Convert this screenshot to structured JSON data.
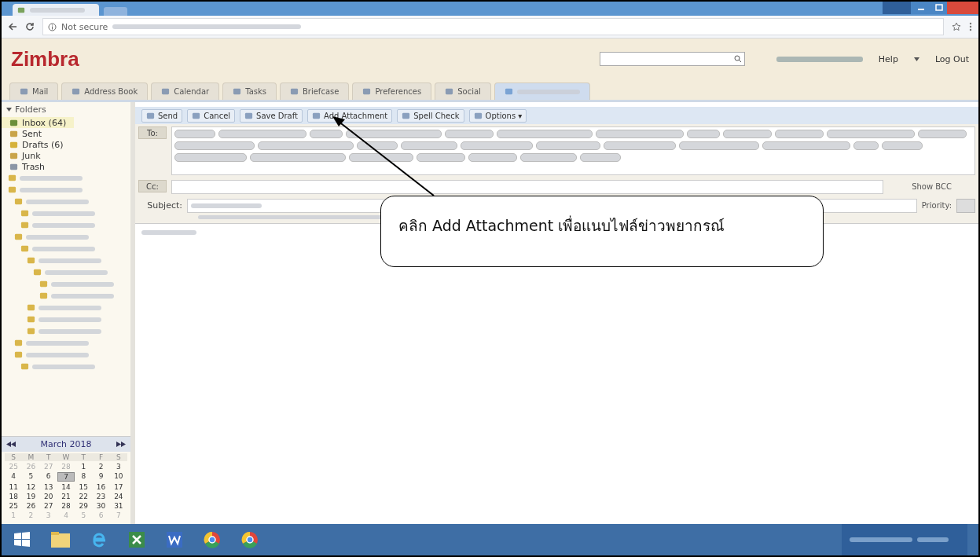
{
  "browser": {
    "security": "Not secure"
  },
  "header": {
    "logo": "Zimbra",
    "help": "Help",
    "logout": "Log Out"
  },
  "app_tabs": [
    {
      "label": "Mail",
      "selected": false
    },
    {
      "label": "Address Book",
      "selected": false
    },
    {
      "label": "Calendar",
      "selected": false
    },
    {
      "label": "Tasks",
      "selected": false
    },
    {
      "label": "Briefcase",
      "selected": false
    },
    {
      "label": "Preferences",
      "selected": false
    },
    {
      "label": "Social",
      "selected": false
    },
    {
      "selected": true
    }
  ],
  "sidebar": {
    "title": "Folders",
    "items": [
      {
        "label": "Inbox (64)",
        "selected": true
      },
      {
        "label": "Sent",
        "selected": false
      },
      {
        "label": "Drafts (6)",
        "selected": false
      },
      {
        "label": "Junk",
        "selected": false
      },
      {
        "label": "Trash",
        "selected": false
      }
    ]
  },
  "calendar": {
    "month": "March 2018",
    "weekdays": [
      "S",
      "M",
      "T",
      "W",
      "T",
      "F",
      "S"
    ],
    "weeks": [
      [
        {
          "d": "25",
          "other": true
        },
        {
          "d": "26",
          "other": true
        },
        {
          "d": "27",
          "other": true
        },
        {
          "d": "28",
          "other": true
        },
        {
          "d": "1"
        },
        {
          "d": "2"
        },
        {
          "d": "3"
        }
      ],
      [
        {
          "d": "4"
        },
        {
          "d": "5"
        },
        {
          "d": "6"
        },
        {
          "d": "7",
          "today": true
        },
        {
          "d": "8"
        },
        {
          "d": "9"
        },
        {
          "d": "10"
        }
      ],
      [
        {
          "d": "11"
        },
        {
          "d": "12"
        },
        {
          "d": "13"
        },
        {
          "d": "14"
        },
        {
          "d": "15"
        },
        {
          "d": "16"
        },
        {
          "d": "17"
        }
      ],
      [
        {
          "d": "18"
        },
        {
          "d": "19"
        },
        {
          "d": "20"
        },
        {
          "d": "21"
        },
        {
          "d": "22"
        },
        {
          "d": "23"
        },
        {
          "d": "24"
        }
      ],
      [
        {
          "d": "25"
        },
        {
          "d": "26"
        },
        {
          "d": "27"
        },
        {
          "d": "28"
        },
        {
          "d": "29"
        },
        {
          "d": "30"
        },
        {
          "d": "31"
        }
      ],
      [
        {
          "d": "1",
          "other": true
        },
        {
          "d": "2",
          "other": true
        },
        {
          "d": "3",
          "other": true
        },
        {
          "d": "4",
          "other": true
        },
        {
          "d": "5",
          "other": true
        },
        {
          "d": "6",
          "other": true
        },
        {
          "d": "7",
          "other": true
        }
      ]
    ]
  },
  "toolbar": [
    {
      "label": "Send"
    },
    {
      "label": "Cancel"
    },
    {
      "label": "Save Draft"
    },
    {
      "label": "Add Attachment"
    },
    {
      "label": "Spell Check"
    },
    {
      "label": "Options ▾"
    }
  ],
  "compose": {
    "to_label": "To:",
    "cc_label": "Cc:",
    "subject_label": "Subject:",
    "show_bcc": "Show BCC",
    "priority": "Priority:"
  },
  "callout": {
    "text": "คลิก Add Attachment เพื่อแนบไฟล์ข่าวพยากรณ์"
  }
}
